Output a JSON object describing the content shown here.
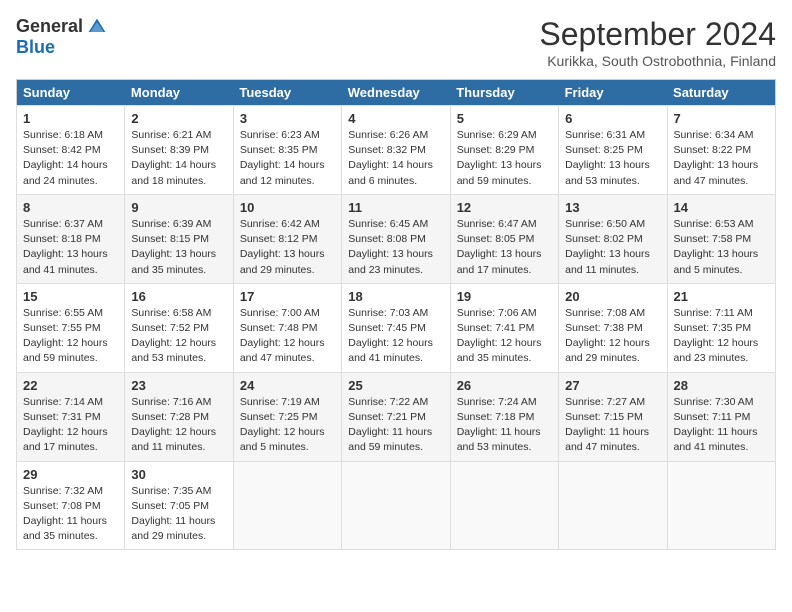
{
  "header": {
    "logo_general": "General",
    "logo_blue": "Blue",
    "month_year": "September 2024",
    "location": "Kurikka, South Ostrobothnia, Finland"
  },
  "weekdays": [
    "Sunday",
    "Monday",
    "Tuesday",
    "Wednesday",
    "Thursday",
    "Friday",
    "Saturday"
  ],
  "weeks": [
    [
      {
        "day": "1",
        "sunrise": "6:18 AM",
        "sunset": "8:42 PM",
        "daylight": "14 hours and 24 minutes."
      },
      {
        "day": "2",
        "sunrise": "6:21 AM",
        "sunset": "8:39 PM",
        "daylight": "14 hours and 18 minutes."
      },
      {
        "day": "3",
        "sunrise": "6:23 AM",
        "sunset": "8:35 PM",
        "daylight": "14 hours and 12 minutes."
      },
      {
        "day": "4",
        "sunrise": "6:26 AM",
        "sunset": "8:32 PM",
        "daylight": "14 hours and 6 minutes."
      },
      {
        "day": "5",
        "sunrise": "6:29 AM",
        "sunset": "8:29 PM",
        "daylight": "13 hours and 59 minutes."
      },
      {
        "day": "6",
        "sunrise": "6:31 AM",
        "sunset": "8:25 PM",
        "daylight": "13 hours and 53 minutes."
      },
      {
        "day": "7",
        "sunrise": "6:34 AM",
        "sunset": "8:22 PM",
        "daylight": "13 hours and 47 minutes."
      }
    ],
    [
      {
        "day": "8",
        "sunrise": "6:37 AM",
        "sunset": "8:18 PM",
        "daylight": "13 hours and 41 minutes."
      },
      {
        "day": "9",
        "sunrise": "6:39 AM",
        "sunset": "8:15 PM",
        "daylight": "13 hours and 35 minutes."
      },
      {
        "day": "10",
        "sunrise": "6:42 AM",
        "sunset": "8:12 PM",
        "daylight": "13 hours and 29 minutes."
      },
      {
        "day": "11",
        "sunrise": "6:45 AM",
        "sunset": "8:08 PM",
        "daylight": "13 hours and 23 minutes."
      },
      {
        "day": "12",
        "sunrise": "6:47 AM",
        "sunset": "8:05 PM",
        "daylight": "13 hours and 17 minutes."
      },
      {
        "day": "13",
        "sunrise": "6:50 AM",
        "sunset": "8:02 PM",
        "daylight": "13 hours and 11 minutes."
      },
      {
        "day": "14",
        "sunrise": "6:53 AM",
        "sunset": "7:58 PM",
        "daylight": "13 hours and 5 minutes."
      }
    ],
    [
      {
        "day": "15",
        "sunrise": "6:55 AM",
        "sunset": "7:55 PM",
        "daylight": "12 hours and 59 minutes."
      },
      {
        "day": "16",
        "sunrise": "6:58 AM",
        "sunset": "7:52 PM",
        "daylight": "12 hours and 53 minutes."
      },
      {
        "day": "17",
        "sunrise": "7:00 AM",
        "sunset": "7:48 PM",
        "daylight": "12 hours and 47 minutes."
      },
      {
        "day": "18",
        "sunrise": "7:03 AM",
        "sunset": "7:45 PM",
        "daylight": "12 hours and 41 minutes."
      },
      {
        "day": "19",
        "sunrise": "7:06 AM",
        "sunset": "7:41 PM",
        "daylight": "12 hours and 35 minutes."
      },
      {
        "day": "20",
        "sunrise": "7:08 AM",
        "sunset": "7:38 PM",
        "daylight": "12 hours and 29 minutes."
      },
      {
        "day": "21",
        "sunrise": "7:11 AM",
        "sunset": "7:35 PM",
        "daylight": "12 hours and 23 minutes."
      }
    ],
    [
      {
        "day": "22",
        "sunrise": "7:14 AM",
        "sunset": "7:31 PM",
        "daylight": "12 hours and 17 minutes."
      },
      {
        "day": "23",
        "sunrise": "7:16 AM",
        "sunset": "7:28 PM",
        "daylight": "12 hours and 11 minutes."
      },
      {
        "day": "24",
        "sunrise": "7:19 AM",
        "sunset": "7:25 PM",
        "daylight": "12 hours and 5 minutes."
      },
      {
        "day": "25",
        "sunrise": "7:22 AM",
        "sunset": "7:21 PM",
        "daylight": "11 hours and 59 minutes."
      },
      {
        "day": "26",
        "sunrise": "7:24 AM",
        "sunset": "7:18 PM",
        "daylight": "11 hours and 53 minutes."
      },
      {
        "day": "27",
        "sunrise": "7:27 AM",
        "sunset": "7:15 PM",
        "daylight": "11 hours and 47 minutes."
      },
      {
        "day": "28",
        "sunrise": "7:30 AM",
        "sunset": "7:11 PM",
        "daylight": "11 hours and 41 minutes."
      }
    ],
    [
      {
        "day": "29",
        "sunrise": "7:32 AM",
        "sunset": "7:08 PM",
        "daylight": "11 hours and 35 minutes."
      },
      {
        "day": "30",
        "sunrise": "7:35 AM",
        "sunset": "7:05 PM",
        "daylight": "11 hours and 29 minutes."
      },
      null,
      null,
      null,
      null,
      null
    ]
  ],
  "labels": {
    "sunrise": "Sunrise:",
    "sunset": "Sunset:",
    "daylight": "Daylight:"
  }
}
